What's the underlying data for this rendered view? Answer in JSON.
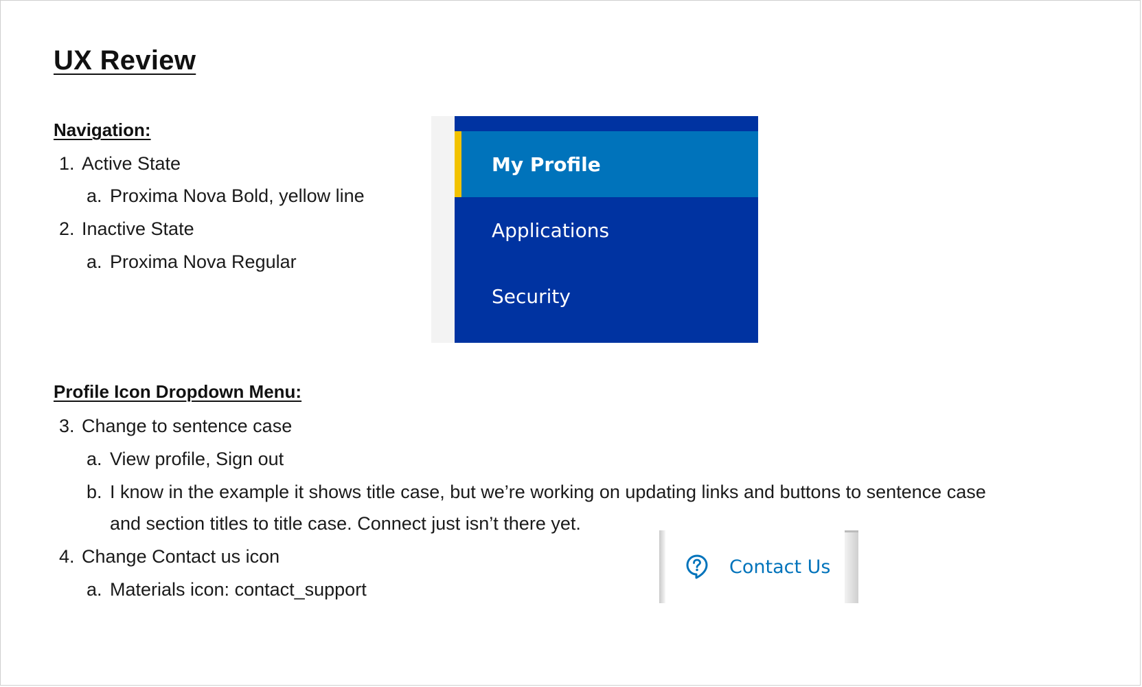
{
  "document": {
    "title": "UX Review"
  },
  "navigation_section": {
    "heading": "Navigation:",
    "items": [
      {
        "num": "1.",
        "text": "Active State"
      },
      {
        "num": "a.",
        "text": "Proxima Nova Bold, yellow line"
      },
      {
        "num": "2.",
        "text": "Inactive State"
      },
      {
        "num": "a.",
        "text": "Proxima Nova Regular"
      }
    ]
  },
  "nav_mockup": {
    "items": [
      {
        "label": "My Profile",
        "active": true
      },
      {
        "label": "Applications",
        "active": false
      },
      {
        "label": "Security",
        "active": false
      }
    ],
    "colors": {
      "panel": "#0033a1",
      "active_bg": "#0073bb",
      "active_indicator": "#f2c200",
      "text": "#ffffff"
    }
  },
  "dropdown_section": {
    "heading": "Profile Icon Dropdown Menu:",
    "items": [
      {
        "num": "3.",
        "text": "Change to sentence case"
      },
      {
        "num": "a.",
        "text": "View profile, Sign out"
      },
      {
        "num": "b.",
        "text": "I know in the example it shows title case, but we’re working on updating links and buttons to sentence case"
      },
      {
        "num": "",
        "text": "and section titles to title case. Connect just isn’t there yet."
      },
      {
        "num": "4.",
        "text": "Change Contact us icon"
      },
      {
        "num": "a.",
        "text": "Materials icon: contact_support"
      }
    ]
  },
  "contact_mockup": {
    "icon": "question-bubble-icon",
    "label": "Contact Us",
    "color": "#0073bb"
  }
}
